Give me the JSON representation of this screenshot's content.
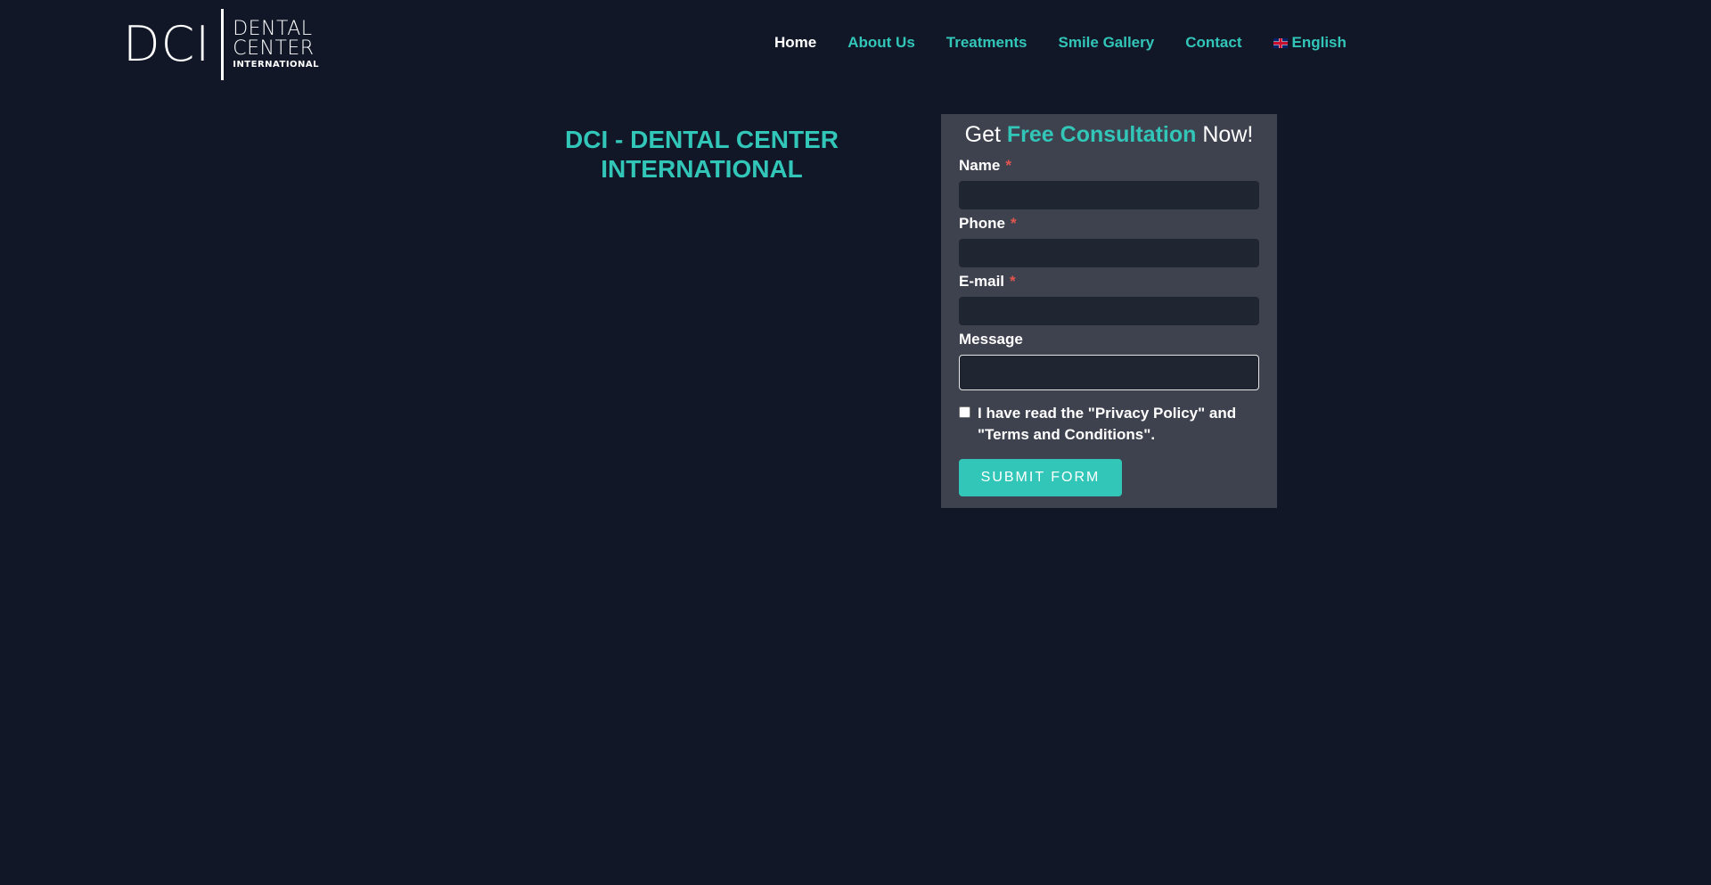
{
  "logo": {
    "mark": "DCI",
    "line1": "DENTAL",
    "line2": "CENTER",
    "line3": "INTERNATIONAL"
  },
  "nav": {
    "items": [
      {
        "label": "Home",
        "active": true
      },
      {
        "label": "About Us"
      },
      {
        "label": "Treatments"
      },
      {
        "label": "Smile Gallery"
      },
      {
        "label": "Contact"
      }
    ],
    "language": {
      "label": "English",
      "flag_icon": "uk-flag-icon"
    }
  },
  "hero": {
    "title": "DCI - DENTAL CENTER INTERNATIONAL"
  },
  "form": {
    "heading_pre": "Get ",
    "heading_accent": "Free Consultation",
    "heading_post": " Now!",
    "fields": {
      "name": {
        "label": "Name",
        "required_mark": "*",
        "value": ""
      },
      "phone": {
        "label": "Phone",
        "required_mark": "*",
        "value": ""
      },
      "email": {
        "label": "E-mail",
        "required_mark": "*",
        "value": ""
      },
      "message": {
        "label": "Message",
        "value": ""
      }
    },
    "consent": {
      "text": "I have read the \"Privacy Policy\" and \"Terms and Conditions\".",
      "checked": false
    },
    "submit_label": "SUBMIT FORM"
  },
  "colors": {
    "background": "#111727",
    "accent": "#32c6b9",
    "card": "#3e424e",
    "input": "#1f2632",
    "required": "#e2554f"
  }
}
